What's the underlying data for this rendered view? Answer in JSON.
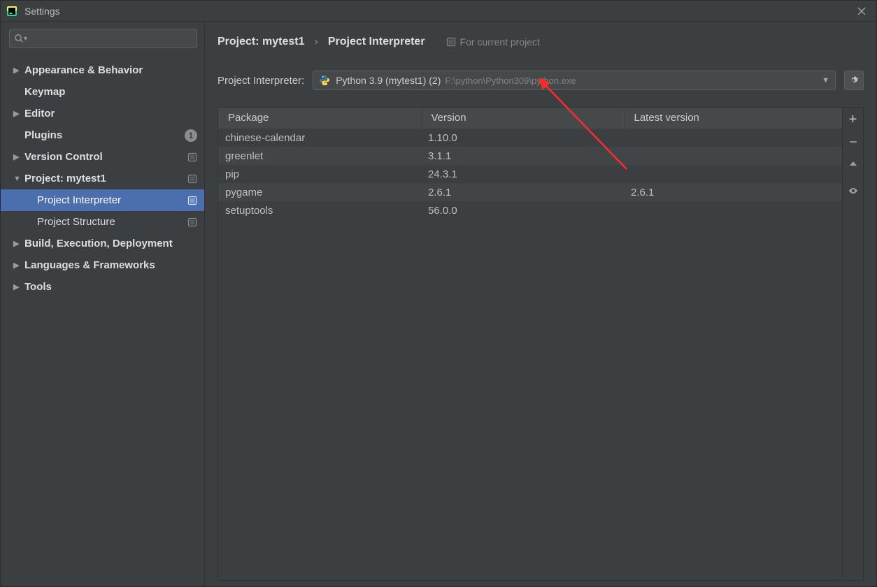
{
  "window": {
    "title": "Settings"
  },
  "sidebar": {
    "search_placeholder": "",
    "items": [
      {
        "label": "Appearance & Behavior",
        "expandable": true,
        "expanded": false
      },
      {
        "label": "Keymap",
        "expandable": false
      },
      {
        "label": "Editor",
        "expandable": true,
        "expanded": false
      },
      {
        "label": "Plugins",
        "expandable": false,
        "badge": "1"
      },
      {
        "label": "Version Control",
        "expandable": true,
        "expanded": false,
        "project_scope": true
      },
      {
        "label": "Project: mytest1",
        "expandable": true,
        "expanded": true,
        "project_scope": true
      },
      {
        "label": "Project Interpreter",
        "level": 2,
        "selected": true,
        "project_scope": true
      },
      {
        "label": "Project Structure",
        "level": 2,
        "project_scope": true
      },
      {
        "label": "Build, Execution, Deployment",
        "expandable": true,
        "expanded": false
      },
      {
        "label": "Languages & Frameworks",
        "expandable": true,
        "expanded": false
      },
      {
        "label": "Tools",
        "expandable": true,
        "expanded": false
      }
    ]
  },
  "breadcrumb": {
    "part1": "Project: mytest1",
    "part2": "Project Interpreter",
    "hint": "For current project"
  },
  "interpreter": {
    "label": "Project Interpreter:",
    "name": "Python 3.9 (mytest1) (2)",
    "path": "F:\\python\\Python309\\python.exe"
  },
  "table": {
    "columns": [
      "Package",
      "Version",
      "Latest version"
    ],
    "rows": [
      {
        "pkg": "chinese-calendar",
        "ver": "1.10.0",
        "lat": ""
      },
      {
        "pkg": "greenlet",
        "ver": "3.1.1",
        "lat": ""
      },
      {
        "pkg": "pip",
        "ver": "24.3.1",
        "lat": ""
      },
      {
        "pkg": "pygame",
        "ver": "2.6.1",
        "lat": "2.6.1"
      },
      {
        "pkg": "setuptools",
        "ver": "56.0.0",
        "lat": ""
      }
    ]
  }
}
